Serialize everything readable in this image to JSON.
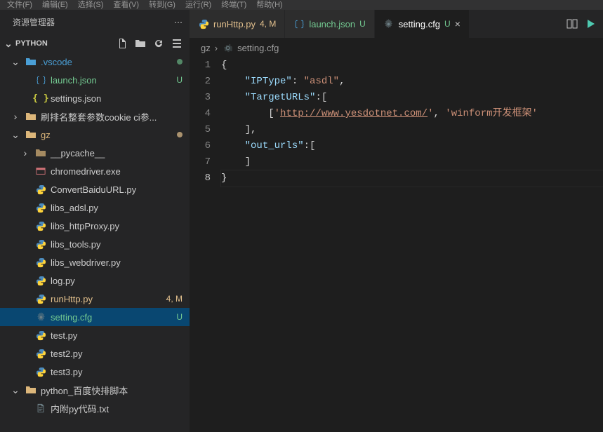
{
  "menubar": [
    "文件(F)",
    "编辑(E)",
    "选择(S)",
    "查看(V)",
    "转到(G)",
    "运行(R)",
    "终端(T)",
    "帮助(H)"
  ],
  "titlebar_file": "setting.cfg",
  "sidebar": {
    "title": "资源管理器",
    "section": "PYTHON",
    "tree": [
      {
        "type": "folder",
        "label": ".vscode",
        "class": "folder-vscode",
        "expanded": true,
        "indent": 0,
        "dot": "dot-green",
        "chev": "down"
      },
      {
        "type": "file",
        "label": "launch.json",
        "icon": "json",
        "indent": 1,
        "status": "U",
        "class": "untracked"
      },
      {
        "type": "file",
        "label": "settings.json",
        "icon": "json-alt",
        "indent": 1
      },
      {
        "type": "folder",
        "label": "刷排名整套参数cookie ci参...",
        "indent": 0,
        "chev": "right"
      },
      {
        "type": "folder",
        "label": "gz",
        "class": "folder-gz",
        "expanded": true,
        "indent": 0,
        "dot": "dot-orange",
        "chev": "down"
      },
      {
        "type": "folder",
        "label": "__pycache__",
        "indent": 1,
        "chev": "right",
        "lighter": true
      },
      {
        "type": "file",
        "label": "chromedriver.exe",
        "icon": "exe",
        "indent": 1
      },
      {
        "type": "file",
        "label": "ConvertBaiduURL.py",
        "icon": "python",
        "indent": 1
      },
      {
        "type": "file",
        "label": "libs_adsl.py",
        "icon": "python",
        "indent": 1
      },
      {
        "type": "file",
        "label": "libs_httpProxy.py",
        "icon": "python",
        "indent": 1
      },
      {
        "type": "file",
        "label": "libs_tools.py",
        "icon": "python",
        "indent": 1
      },
      {
        "type": "file",
        "label": "libs_webdriver.py",
        "icon": "python",
        "indent": 1
      },
      {
        "type": "file",
        "label": "log.py",
        "icon": "python",
        "indent": 1
      },
      {
        "type": "file",
        "label": "runHttp.py",
        "icon": "python",
        "indent": 1,
        "status": "4, M",
        "class": "modified"
      },
      {
        "type": "file",
        "label": "setting.cfg",
        "icon": "cfg",
        "indent": 1,
        "status": "U",
        "class": "untracked",
        "selected": true
      },
      {
        "type": "file",
        "label": "test.py",
        "icon": "python",
        "indent": 1
      },
      {
        "type": "file",
        "label": "test2.py",
        "icon": "python",
        "indent": 1
      },
      {
        "type": "file",
        "label": "test3.py",
        "icon": "python",
        "indent": 1
      },
      {
        "type": "folder",
        "label": "python_百度快排脚本",
        "indent": 0,
        "chev": "down"
      },
      {
        "type": "file",
        "label": "内附py代码.txt",
        "icon": "txt",
        "indent": 1
      }
    ]
  },
  "tabs": [
    {
      "icon": "python",
      "label": "runHttp.py",
      "status": "4, M",
      "statusClass": "m",
      "labelClass": "orange"
    },
    {
      "icon": "json",
      "label": "launch.json",
      "status": "U",
      "statusClass": "u",
      "labelClass": "green"
    },
    {
      "icon": "cfg",
      "label": "setting.cfg",
      "status": "U",
      "statusClass": "u",
      "labelClass": "white",
      "active": true,
      "close": true
    }
  ],
  "breadcrumb": {
    "folder": "gz",
    "file": "setting.cfg"
  },
  "code": {
    "lines": [
      {
        "n": "1",
        "html": "<span class='brace'>{</span>"
      },
      {
        "n": "2",
        "html": "    <span class='key'>\"IPType\"</span><span class='punc'>: </span><span class='string'>\"asdl\"</span><span class='punc'>,</span>"
      },
      {
        "n": "3",
        "html": "    <span class='key'>\"TargetURLs\"</span><span class='punc'>:[</span>"
      },
      {
        "n": "4",
        "html": "        <span class='punc'>[</span><span class='string'>'<span class='url'>http://www.yesdotnet.com/</span>'</span><span class='punc'>, </span><span class='string'>'winform开发框架'</span>"
      },
      {
        "n": "5",
        "html": "    <span class='punc'>],</span>"
      },
      {
        "n": "6",
        "html": "    <span class='key'>\"out_urls\"</span><span class='punc'>:[</span>"
      },
      {
        "n": "7",
        "html": "    <span class='punc'>]</span>"
      },
      {
        "n": "8",
        "html": "<span class='brace'>}</span>"
      }
    ]
  }
}
